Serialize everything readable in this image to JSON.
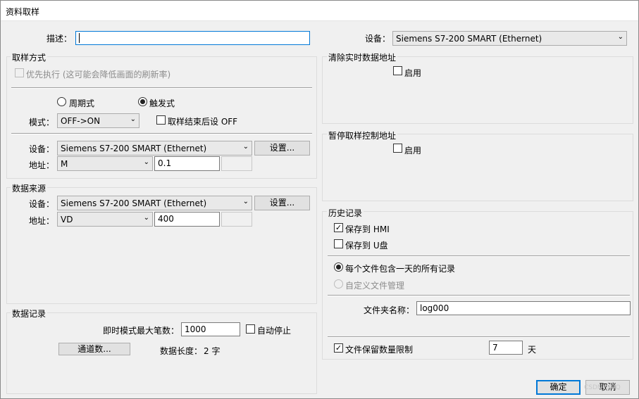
{
  "window": {
    "title": "资料取样"
  },
  "top": {
    "desc_label": "描述：",
    "desc_value": "",
    "device_label": "设备：",
    "device_value": "Siemens S7-200 SMART (Ethernet)"
  },
  "sampling": {
    "title": "取样方式",
    "priority_label": "优先执行 (这可能会降低画面的刷新率)",
    "priority_checked": false,
    "periodic_label": "周期式",
    "trigger_label": "触发式",
    "selected": "trigger",
    "mode_label": "模式：",
    "mode_value": "OFF->ON",
    "reset_label": "取样结束后设 OFF",
    "reset_checked": false,
    "device_label": "设备：",
    "device_value": "Siemens S7-200 SMART (Ethernet)",
    "settings_button": "设置...",
    "address_label": "地址：",
    "address_type": "M",
    "address_value": "0.1"
  },
  "source": {
    "title": "数据来源",
    "device_label": "设备：",
    "device_value": "Siemens S7-200 SMART (Ethernet)",
    "settings_button": "设置...",
    "address_label": "地址：",
    "address_type": "VD",
    "address_value": "400"
  },
  "record": {
    "title": "数据记录",
    "max_count_label": "即时模式最大笔数：",
    "max_count_value": "1000",
    "auto_stop_label": "自动停止",
    "auto_stop_checked": false,
    "channels_button": "通道数...",
    "length_label": "数据长度：",
    "length_value": "2 字"
  },
  "clear_realtime": {
    "title": "清除实时数据地址",
    "enable_label": "启用",
    "enabled": false
  },
  "pause_control": {
    "title": "暂停取样控制地址",
    "enable_label": "启用",
    "enabled": false
  },
  "history": {
    "title": "历史记录",
    "save_hmi_label": "保存到 HMI",
    "save_hmi_checked": true,
    "save_usb_label": "保存到 U盘",
    "save_usb_checked": false,
    "daily_label": "每个文件包含一天的所有记录",
    "custom_label": "自定义文件管理",
    "file_mode": "daily",
    "folder_label": "文件夹名称：",
    "folder_value": "log000",
    "limit_label": "文件保留数量限制",
    "limit_checked": true,
    "limit_value": "7",
    "limit_unit": "天"
  },
  "footer": {
    "ok_button": "确定",
    "cancel_button": "取消",
    "watermark": "CSDN @QQ"
  },
  "icons": {
    "dropdown": "chevron-down-icon",
    "checkbox_mark": "checkmark-icon"
  }
}
